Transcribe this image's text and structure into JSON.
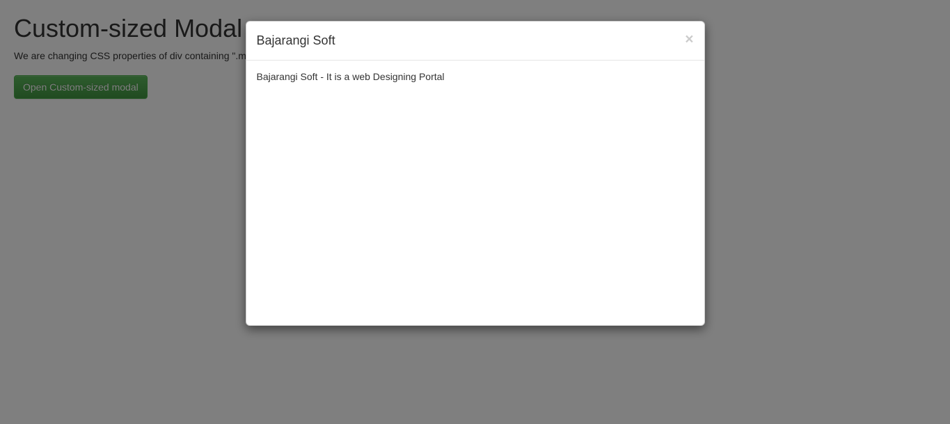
{
  "page": {
    "title": "Custom-sized Modal",
    "lead": "We are changing CSS properties of div containing \".modal-dialog\" class to Custom size the modal.",
    "open_button_label": "Open Custom-sized modal"
  },
  "modal": {
    "title": "Bajarangi Soft",
    "body": "Bajarangi Soft - It is a web Designing Portal",
    "close_glyph": "×"
  }
}
